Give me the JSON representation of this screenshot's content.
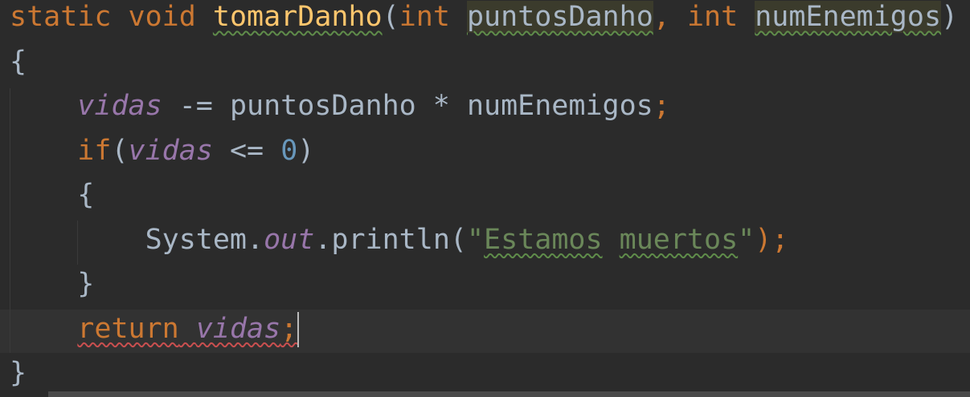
{
  "code": {
    "l1": {
      "kw1": "static",
      "kw2": "void",
      "fn": "tomarDanho",
      "p1": "(",
      "kw3": "int",
      "a1": "puntosDanho",
      "c": ",",
      "kw4": "int",
      "a2": "numEnemigos",
      "p2": ")"
    },
    "l2": "{",
    "l3": {
      "f": "vidas",
      "op": " -= puntosDanho * numEnemigos",
      "semi": ";"
    },
    "l4": {
      "kw": "if",
      "p1": "(",
      "f": "vidas",
      "op": " <= ",
      "n": "0",
      "p2": ")"
    },
    "l5": "{",
    "l6": {
      "a": "System.",
      "f": "out",
      "b": ".println(",
      "s1": "\"",
      "w1": "Estamos",
      "sp": " ",
      "w2": "muertos",
      "s2": "\"",
      "c": ");"
    },
    "l7": "}",
    "l8": {
      "kw": "return",
      "f": "vidas",
      "semi": ";"
    },
    "l9": "}"
  }
}
